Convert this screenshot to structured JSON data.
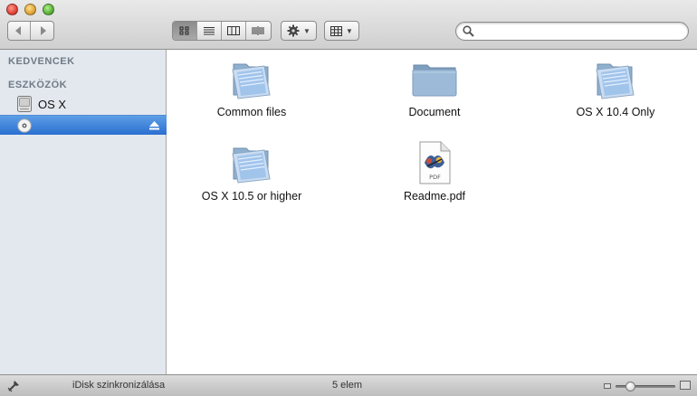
{
  "toolbar": {
    "back_icon": "chevron-left-icon",
    "forward_icon": "chevron-right-icon",
    "view_modes": [
      {
        "id": "icon",
        "icon": "icon-view-icon",
        "active": true
      },
      {
        "id": "list",
        "icon": "list-view-icon",
        "active": false
      },
      {
        "id": "columns",
        "icon": "column-view-icon",
        "active": false
      },
      {
        "id": "coverflow",
        "icon": "coverflow-view-icon",
        "active": false
      }
    ],
    "action_icon": "gear-icon",
    "arrange_icon": "grid-arrange-icon",
    "search": {
      "value": "",
      "placeholder": ""
    }
  },
  "sidebar": {
    "favorites_header": "KEDVENCEK",
    "devices_header": "ESZKÖZÖK",
    "devices": [
      {
        "label": "OS X",
        "icon": "hard-drive-icon",
        "selected": false
      },
      {
        "label": "",
        "icon": "disc-icon",
        "selected": true,
        "ejectable": true
      }
    ],
    "selection_color": "#3a82dc"
  },
  "files": [
    {
      "name": "Common files",
      "type": "folder"
    },
    {
      "name": "Document",
      "type": "folder-plain"
    },
    {
      "name": "OS X 10.4 Only",
      "type": "folder"
    },
    {
      "name": "OS X 10.5 or higher",
      "type": "folder"
    },
    {
      "name": "Readme.pdf",
      "type": "pdf",
      "badge": "PDF"
    }
  ],
  "statusbar": {
    "sync_text": "iDisk szinkronizálása",
    "item_count": "5 elem",
    "zoom_level": 0.2
  }
}
